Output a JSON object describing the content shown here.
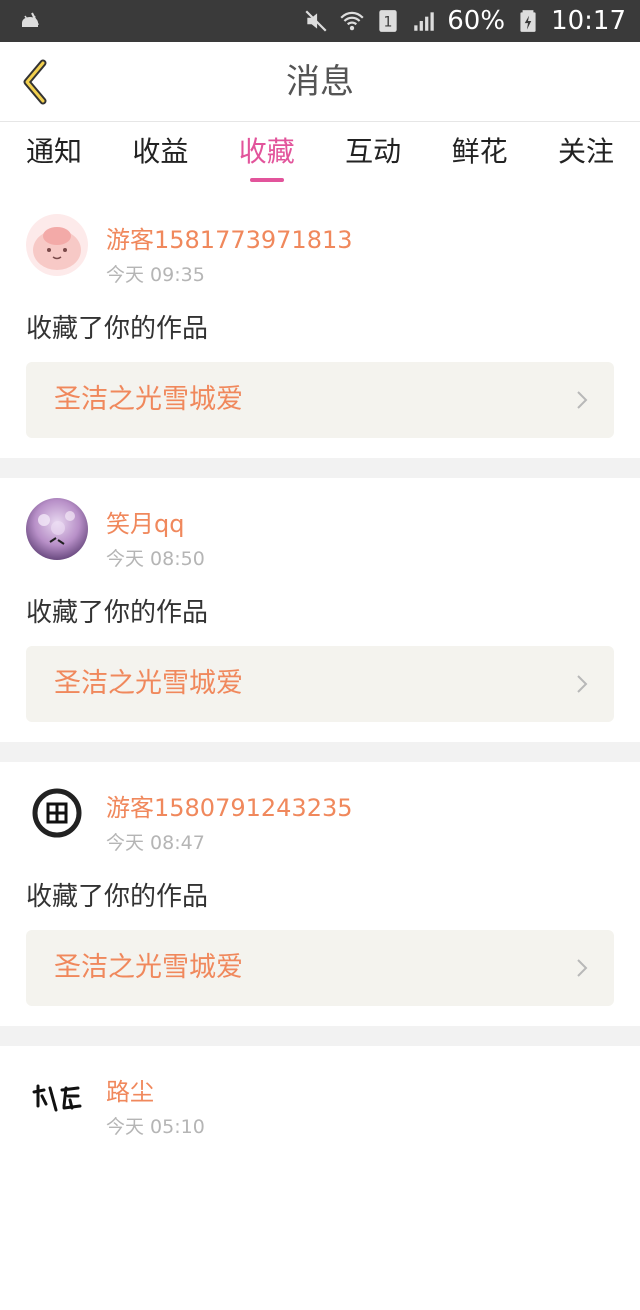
{
  "status_bar": {
    "battery": "60%",
    "time": "10:17",
    "icons": [
      "android-debug-icon",
      "mute-icon",
      "wifi-icon",
      "sim-1-icon",
      "signal-icon",
      "battery-charging-icon"
    ]
  },
  "header": {
    "title": "消息"
  },
  "tabs": [
    {
      "label": "通知"
    },
    {
      "label": "收益"
    },
    {
      "label": "收藏"
    },
    {
      "label": "互动"
    },
    {
      "label": "鲜花"
    },
    {
      "label": "关注"
    }
  ],
  "active_tab": "收藏",
  "accent_color": "#e2549b",
  "name_color": "#f0885c",
  "messages": [
    {
      "user": "游客1581773971813",
      "time": "今天 09:35",
      "action": "收藏了你的作品",
      "work": "圣洁之光雪城爱"
    },
    {
      "user": "笑月qq",
      "time": "今天 08:50",
      "action": "收藏了你的作品",
      "work": "圣洁之光雪城爱"
    },
    {
      "user": "游客1580791243235",
      "time": "今天 08:47",
      "action": "收藏了你的作品",
      "work": "圣洁之光雪城爱"
    },
    {
      "user": "路尘",
      "time": "今天 05:10"
    }
  ]
}
